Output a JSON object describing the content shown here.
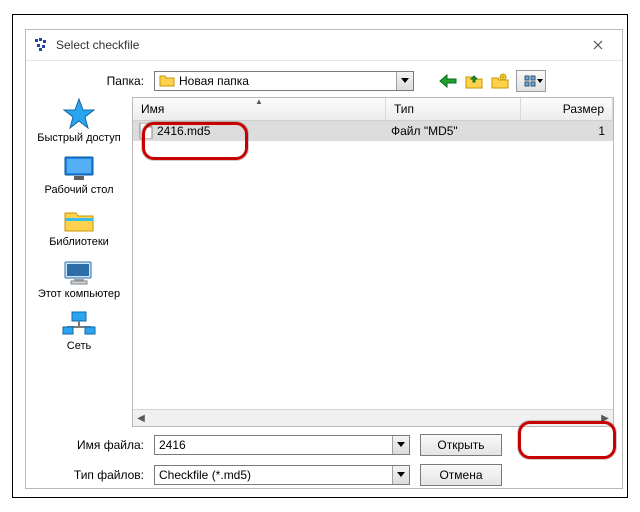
{
  "title": "Select checkfile",
  "toolbar": {
    "folder_label": "Папка:",
    "current_folder": "Новая папка"
  },
  "places": [
    {
      "label": "Быстрый доступ"
    },
    {
      "label": "Рабочий стол"
    },
    {
      "label": "Библиотеки"
    },
    {
      "label": "Этот компьютер"
    },
    {
      "label": "Сеть"
    }
  ],
  "columns": {
    "name": "Имя",
    "type": "Тип",
    "size": "Размер"
  },
  "files": [
    {
      "name": "2416.md5",
      "type": "Файл \"MD5\"",
      "size": "1"
    }
  ],
  "form": {
    "filename_label": "Имя файла:",
    "filename_value": "2416",
    "filetype_label": "Тип файлов:",
    "filetype_value": "Checkfile (*.md5)"
  },
  "buttons": {
    "open": "Открыть",
    "cancel": "Отмена"
  }
}
